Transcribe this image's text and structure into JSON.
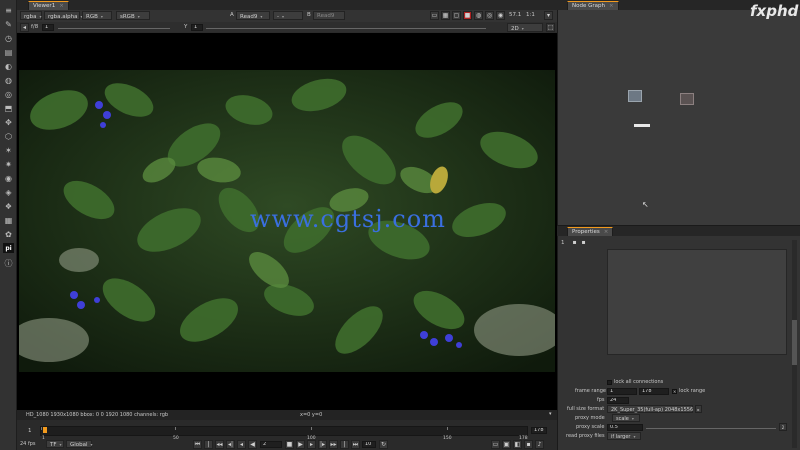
{
  "viewer": {
    "tab_label": "Viewer1",
    "channels": "rgba",
    "channel_alpha": "rgba.alpha",
    "colorspace_display": "RGB",
    "colorspace_lut": "sRGB",
    "input_a_letter": "A",
    "input_a": "Read9",
    "input_mid": "-",
    "input_b_letter": "B",
    "input_b": "Read9",
    "gain": "57.1",
    "zoom": "1:1",
    "fstop_label": "f/8",
    "frame_value": "1",
    "y_label": "Y",
    "y_value": "1",
    "proxy_res": "2D",
    "status_format": "HD_1080 1930x1080  bbox: 0 0 1920 1080 channels: rgb",
    "status_coords": "x=0 y=0"
  },
  "timeline": {
    "current_frame_left": "1",
    "start": "1",
    "tick_50": "50",
    "tick_100": "100",
    "tick_150": "150",
    "end_marker": "178",
    "end_field": "178",
    "fps": "24 fps",
    "tf_label": "TF",
    "global_label": "Global",
    "frame_field": "2",
    "increment_field": "10",
    "progress": 0.0
  },
  "node_graph": {
    "tab_label": "Node Graph"
  },
  "properties": {
    "tab_label": "Properties",
    "count": "1",
    "lock_all_label": "lock all connections",
    "frame_range_label": "frame range",
    "frame_range_start": "1",
    "frame_range_end": "178",
    "lock_range_label": "lock range",
    "fps_label": "fps",
    "fps_value": "24",
    "full_size_label": "full size format",
    "full_size_value": "2K_Super_35(full-ap) 2048x1556",
    "proxy_mode_label": "proxy mode",
    "proxy_mode_value": "scale",
    "proxy_scale_label": "proxy scale",
    "proxy_scale_value": "0.5",
    "read_proxy_label": "read proxy files",
    "read_proxy_value": "if larger"
  },
  "overlays": {
    "watermark_site": "www.cgtsj.com",
    "brand_logo": "fxphd"
  },
  "colors": {
    "accent_orange": "#f29a1d",
    "panel_bg": "#2b2b2b",
    "link_blue": "#3a6fe0"
  }
}
